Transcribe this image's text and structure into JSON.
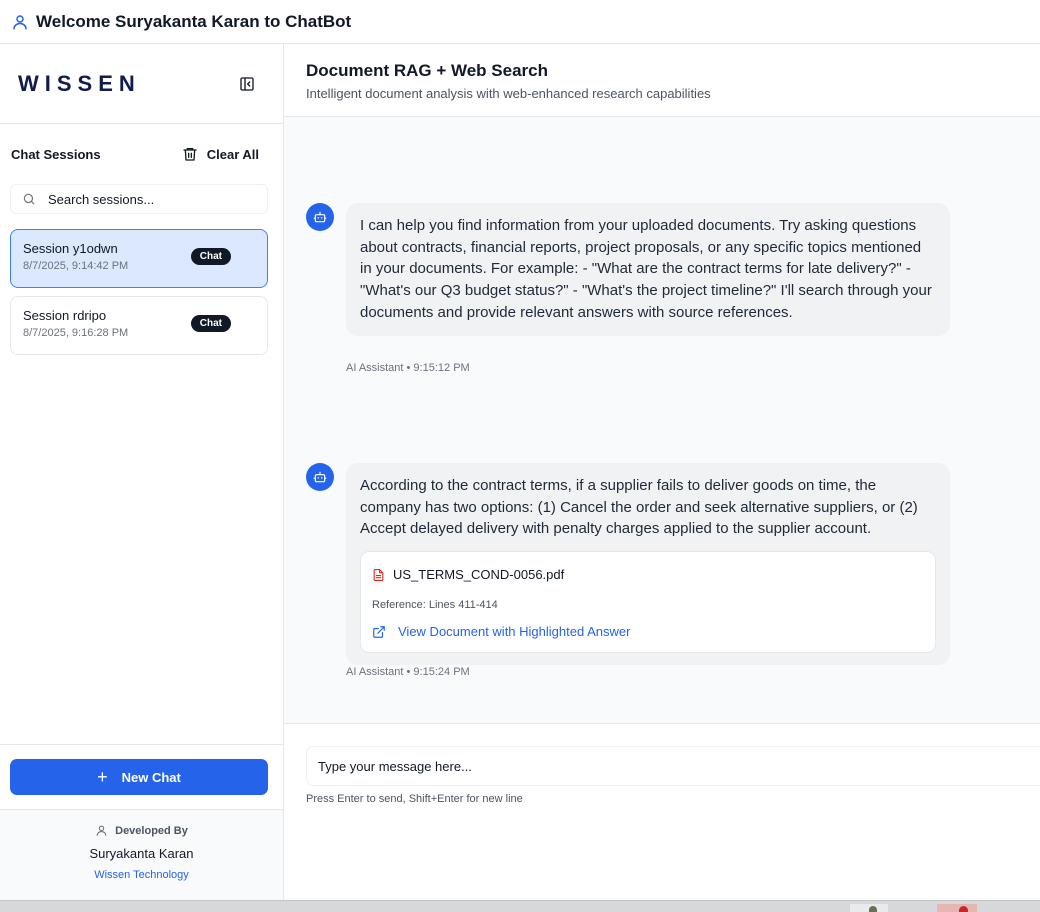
{
  "header": {
    "welcome": "Welcome Suryakanta Karan to ChatBot"
  },
  "sidebar": {
    "logo": "WISSEN",
    "sessions_label": "Chat Sessions",
    "clear_all": "Clear All",
    "search_placeholder": "Search sessions...",
    "sessions": [
      {
        "name": "Session y1odwn",
        "time": "8/7/2025, 9:14:42 PM",
        "badge": "Chat",
        "active": true
      },
      {
        "name": "Session rdripo",
        "time": "8/7/2025, 9:16:28 PM",
        "badge": "Chat",
        "active": false
      }
    ],
    "new_chat": "New Chat",
    "footer": {
      "developed_by": "Developed By",
      "author": "Suryakanta Karan",
      "company": "Wissen Technology"
    }
  },
  "main": {
    "title": "Document RAG + Web Search",
    "subtitle": "Intelligent document analysis with web-enhanced research capabilities",
    "messages": [
      {
        "text": "I can help you find information from your uploaded documents. Try asking questions about contracts, financial reports, project proposals, or any specific topics mentioned in your documents. For example: - \"What are the contract terms for late delivery?\" - \"What's our Q3 budget status?\" - \"What's the project timeline?\" I'll search through your documents and provide relevant answers with source references.",
        "meta": "AI Assistant • 9:15:12 PM"
      },
      {
        "text": "According to the contract terms, if a supplier fails to deliver goods on time, the company has two options: (1) Cancel the order and seek alternative suppliers, or (2) Accept delayed delivery with penalty charges applied to the supplier account.",
        "meta": "AI Assistant • 9:15:24 PM",
        "reference": {
          "file": "US_TERMS_COND-0056.pdf",
          "lines": "Reference: Lines 411-414",
          "link": "View Document with Highlighted Answer"
        }
      }
    ],
    "composer": {
      "placeholder": "Type your message here...",
      "hint": "Press Enter to send, Shift+Enter for new line"
    }
  },
  "colors": {
    "accent": "#2563eb",
    "active_session_bg": "#dbe8fd",
    "pdf_icon": "#dc2626",
    "logo": "#111b4d"
  },
  "icons": [
    "user-icon",
    "collapse-sidebar-icon",
    "trash-icon",
    "search-icon",
    "bot-icon",
    "pdf-file-icon",
    "external-link-icon",
    "plus-icon"
  ]
}
